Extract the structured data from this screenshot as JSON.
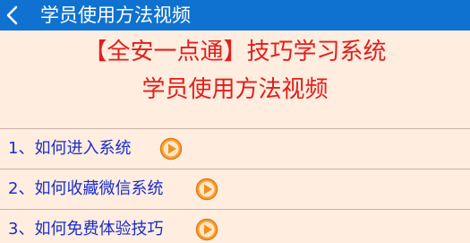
{
  "titlebar": {
    "back_icon": "chevron-left-icon",
    "title": "学员使用方法视频",
    "color": "#0f72d0"
  },
  "heading": {
    "line1": "【全安一点通】技巧学习系统",
    "line2": "学员使用方法视频",
    "color": "#e0201b"
  },
  "videos": [
    {
      "label": "1、如何进入系统",
      "icon": "play-icon"
    },
    {
      "label": "2、如何收藏微信系统",
      "icon": "play-icon"
    },
    {
      "label": "3、如何免费体验技巧",
      "icon": "play-icon"
    }
  ],
  "colors": {
    "background": "#ffede0",
    "list_text": "#1a2dc8",
    "play_icon": "#f0901c"
  }
}
